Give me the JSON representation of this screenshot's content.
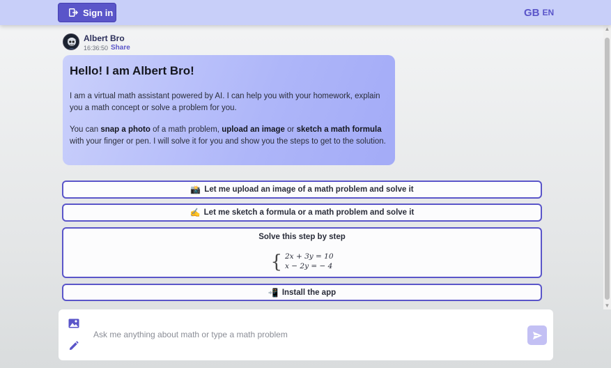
{
  "header": {
    "signin_label": "Sign in",
    "lang_flag": "GB",
    "lang_code": "EN"
  },
  "author": {
    "name": "Albert Bro",
    "time": "16:36:50",
    "share_label": "Share"
  },
  "welcome": {
    "title": "Hello! I am Albert Bro!",
    "p1": "I am a virtual math assistant powered by AI. I can help you with your homework, explain you a math concept or solve a problem for you.",
    "p2_1": "You can ",
    "p2_b1": "snap a photo",
    "p2_2": " of a math problem, ",
    "p2_b2": "upload an image",
    "p2_3": " or ",
    "p2_b3": "sketch a math formula",
    "p2_4": " with your finger or pen. I will solve it for you and show you the steps to get to the solution."
  },
  "actions": {
    "upload": {
      "icon": "📸",
      "label": "Let me upload an image of a math problem and solve it"
    },
    "sketch": {
      "icon": "✍️",
      "label": "Let me sketch a formula or a math problem and solve it"
    },
    "solve": {
      "label": "Solve this step by step",
      "eq1": "2x + 3y = 10",
      "eq2": "x − 2y = − 4"
    },
    "install": {
      "icon": "📲",
      "label": "Install the app"
    }
  },
  "input": {
    "placeholder": "Ask me anything about math or type a math problem"
  },
  "colors": {
    "accent": "#5a55c9",
    "header_bg": "#c8cff9",
    "bubble_start": "#cad0fb",
    "bubble_end": "#a3abf7",
    "send_bg": "#c3c0f4"
  },
  "icons": {
    "signin": "sign-in-icon",
    "image": "image-icon",
    "pen": "pen-icon",
    "send": "send-icon"
  }
}
